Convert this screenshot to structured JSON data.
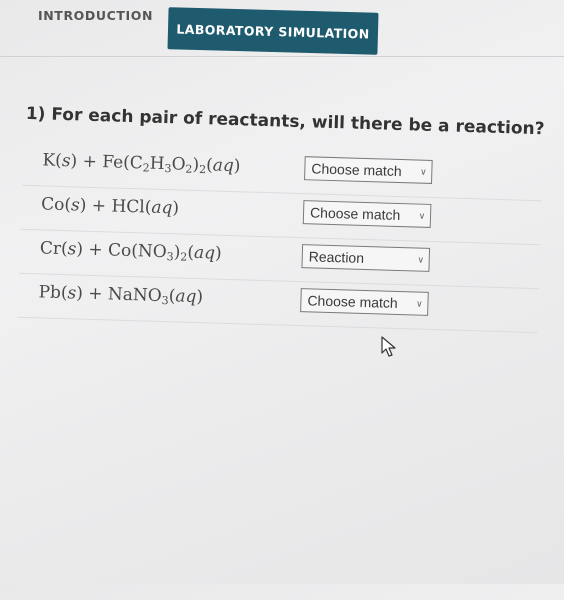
{
  "tabs": [
    {
      "label": "INTRODUCTION"
    },
    {
      "label": "LABORATORY SIMULATION"
    }
  ],
  "question": "1) For each pair of reactants, will there be a reaction?",
  "rows": [
    {
      "formula": "K(s) + Fe(C2H3O2)2(aq)",
      "selection": "Choose match"
    },
    {
      "formula": "Co(s) + HCl(aq)",
      "selection": "Choose match"
    },
    {
      "formula": "Cr(s) + Co(NO3)2(aq)",
      "selection": "Reaction"
    },
    {
      "formula": "Pb(s) + NaNO3(aq)",
      "selection": "Choose match"
    }
  ],
  "icons": {
    "dropdown": "chevron-down-icon",
    "pointer": "mouse-cursor-icon"
  }
}
